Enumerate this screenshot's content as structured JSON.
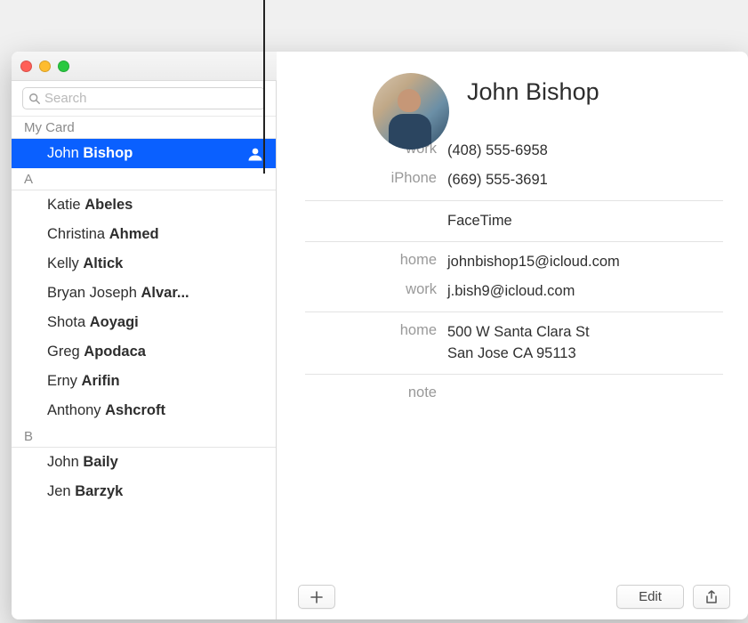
{
  "search": {
    "placeholder": "Search"
  },
  "sidebar": {
    "my_card_label": "My Card",
    "my_card": {
      "first": "John",
      "last": "Bishop"
    },
    "sections": [
      {
        "letter": "A",
        "items": [
          {
            "first": "Katie",
            "last": "Abeles"
          },
          {
            "first": "Christina",
            "last": "Ahmed"
          },
          {
            "first": "Kelly",
            "last": "Altick"
          },
          {
            "first": "Bryan Joseph",
            "last": "Alvar..."
          },
          {
            "first": "Shota",
            "last": "Aoyagi"
          },
          {
            "first": "Greg",
            "last": "Apodaca"
          },
          {
            "first": "Erny",
            "last": "Arifin"
          },
          {
            "first": "Anthony",
            "last": "Ashcroft"
          }
        ]
      },
      {
        "letter": "B",
        "items": [
          {
            "first": "John",
            "last": "Baily"
          },
          {
            "first": "Jen",
            "last": "Barzyk"
          }
        ]
      }
    ]
  },
  "detail": {
    "name": "John Bishop",
    "phones": [
      {
        "label": "work",
        "value": "(408) 555-6958"
      },
      {
        "label": "iPhone",
        "value": "(669) 555-3691"
      }
    ],
    "facetime_label": "FaceTime",
    "emails": [
      {
        "label": "home",
        "value": "johnbishop15@icloud.com"
      },
      {
        "label": "work",
        "value": "j.bish9@icloud.com"
      }
    ],
    "addresses": [
      {
        "label": "home",
        "line1": "500 W Santa Clara St",
        "line2": "San Jose CA 95113"
      }
    ],
    "note_label": "note"
  },
  "toolbar": {
    "edit_label": "Edit"
  }
}
